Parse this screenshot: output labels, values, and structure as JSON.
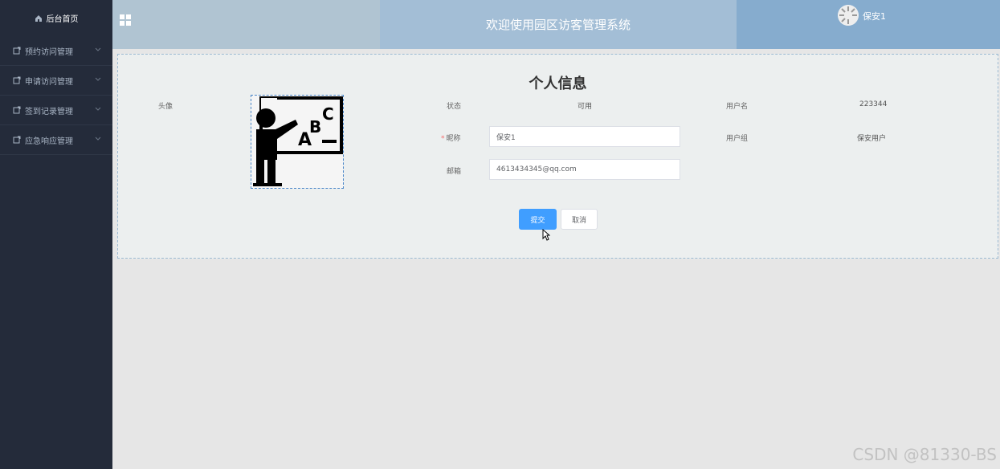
{
  "sidebar": {
    "home_label": "后台首页",
    "items": [
      {
        "label": "预约访问管理"
      },
      {
        "label": "申请访问管理"
      },
      {
        "label": "签到记录管理"
      },
      {
        "label": "应急响应管理"
      }
    ]
  },
  "header": {
    "title": "欢迎使用园区访客管理系统",
    "username": "保安1"
  },
  "profile": {
    "title": "个人信息",
    "avatar_label": "头像",
    "status_label": "状态",
    "status_value": "可用",
    "username_label": "用户名",
    "username_value": "223344",
    "nickname_label": "昵称",
    "nickname_value": "保安1",
    "group_label": "用户组",
    "group_value": "保安用户",
    "email_label": "邮箱",
    "email_value": "4613434345@qq.com",
    "submit_label": "提交",
    "cancel_label": "取消"
  },
  "watermark": "CSDN @81330-BS",
  "colors": {
    "sidebar_bg": "#242b3a",
    "header_left": "#b0c4d2",
    "header_mid": "#a3bed6",
    "header_right": "#86acce",
    "primary": "#409eff"
  },
  "icons": {
    "home": "home-icon",
    "menu": "doc-icon",
    "chevron": "chevron-down-icon",
    "grid": "grid-icon"
  }
}
